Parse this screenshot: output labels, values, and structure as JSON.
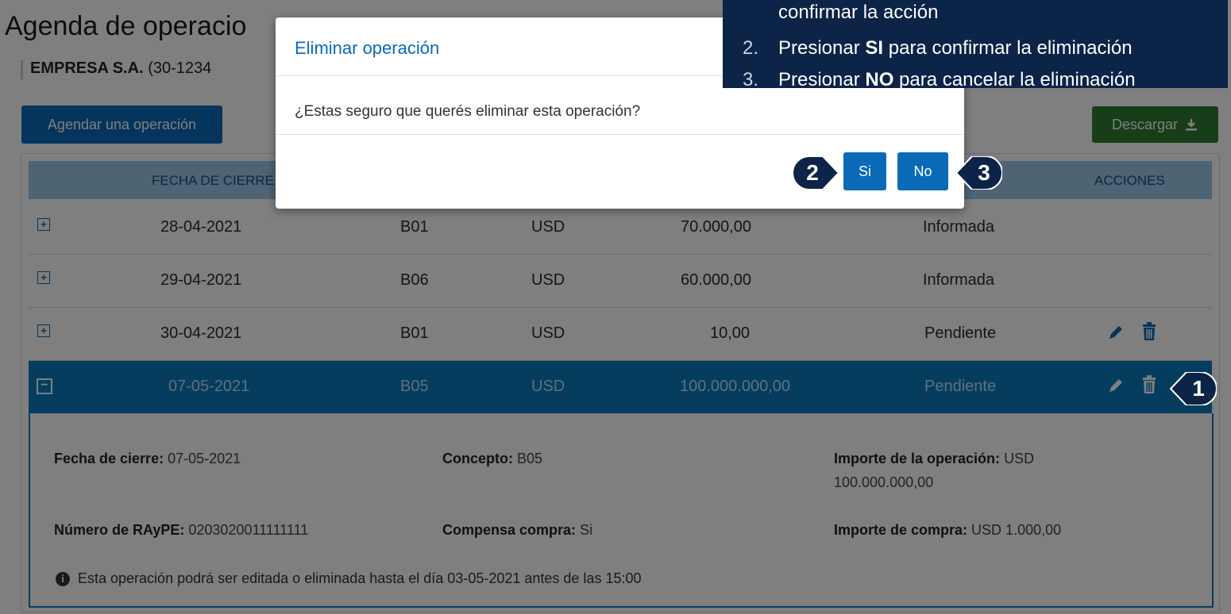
{
  "page": {
    "title": "Agenda de operacio",
    "company_name": "EMPRESA S.A.",
    "company_id": "(30-1234"
  },
  "toolbar": {
    "schedule_label": "Agendar una operación",
    "download_label": "Descargar"
  },
  "table": {
    "headers": {
      "fecha": "FECHA DE CIERRE",
      "acciones": "ACCIONES"
    },
    "rows": [
      {
        "fecha": "28-04-2021",
        "concepto": "B01",
        "moneda": "USD",
        "importe": "70.000,00",
        "estado": "Informada"
      },
      {
        "fecha": "29-04-2021",
        "concepto": "B06",
        "moneda": "USD",
        "importe": "60.000,00",
        "estado": "Informada"
      },
      {
        "fecha": "30-04-2021",
        "concepto": "B01",
        "moneda": "USD",
        "importe": "10,00",
        "estado": "Pendiente"
      },
      {
        "fecha": "07-05-2021",
        "concepto": "B05",
        "moneda": "USD",
        "importe": "100.000.000,00",
        "estado": "Pendiente"
      }
    ]
  },
  "detail": {
    "fecha_label": "Fecha de cierre:",
    "fecha_value": "07-05-2021",
    "concepto_label": "Concepto:",
    "concepto_value": "B05",
    "importe_label": "Importe de la operación:",
    "importe_value_1": "USD",
    "importe_value_2": "100.000.000,00",
    "rayp_label": "Número de RAyPE:",
    "rayp_value": "0203020011111111",
    "compensa_label": "Compensa compra:",
    "compensa_value": "Si",
    "compra_label": "Importe de compra:",
    "compra_value": "USD 1.000,00",
    "info_text": "Esta operación podrá ser editada o eliminada hasta el día 03-05-2021 antes de las 15:00"
  },
  "modal": {
    "title": "Eliminar operación",
    "message": "¿Estas seguro que querés eliminar esta operación?",
    "yes_label": "Si",
    "no_label": "No"
  },
  "callout": {
    "line0": "confirmar la acción",
    "line2_num": "2.",
    "line2_pre": "Presionar ",
    "line2_bold": "SI",
    "line2_post": " para confirmar la eliminación",
    "line3_num": "3.",
    "line3_pre": "Presionar ",
    "line3_bold": "NO",
    "line3_post": " para cancelar la eliminación"
  },
  "badges": {
    "b1": "1",
    "b2": "2",
    "b3": "3"
  },
  "colors": {
    "primary": "#0a6ab8",
    "download": "#2e7d32",
    "callout_bg": "#0b2447",
    "active_row": "#0a7bbf"
  },
  "icons": [
    "expand-icon",
    "collapse-icon",
    "edit-icon",
    "trash-icon",
    "download-icon",
    "info-icon"
  ]
}
